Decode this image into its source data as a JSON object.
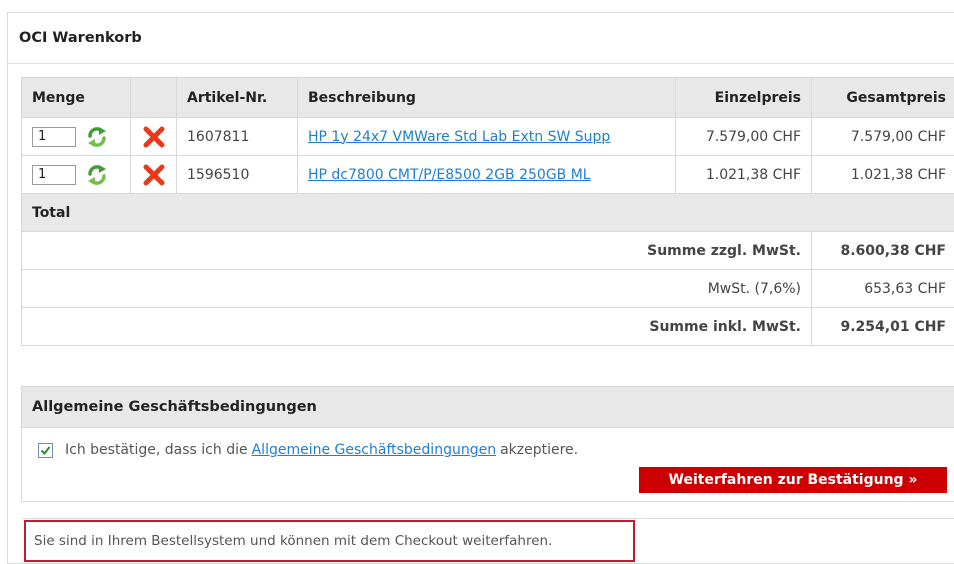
{
  "cart": {
    "title": "OCI Warenkorb",
    "columns": {
      "menge": "Menge",
      "artikel": "Artikel-Nr.",
      "beschreibung": "Beschreibung",
      "einzelpreis": "Einzelpreis",
      "gesamtpreis": "Gesamtpreis"
    },
    "items": [
      {
        "qty": "1",
        "article_no": "1607811",
        "description": "HP 1y 24x7 VMWare Std Lab Extn SW Supp",
        "unit_price": "7.579,00 CHF",
        "total_price": "7.579,00 CHF"
      },
      {
        "qty": "1",
        "article_no": "1596510",
        "description": "HP dc7800 CMT/P/E8500 2GB 250GB ML",
        "unit_price": "1.021,38 CHF",
        "total_price": "1.021,38 CHF"
      }
    ],
    "total": {
      "label": "Total",
      "subtotal_label": "Summe zzgl. MwSt.",
      "subtotal_value": "8.600,38 CHF",
      "vat_label": "MwSt. (7,6%)",
      "vat_value": "653,63 CHF",
      "grand_label": "Summe inkl. MwSt.",
      "grand_value": "9.254,01 CHF"
    }
  },
  "terms": {
    "heading": "Allgemeine Geschäftsbedingungen",
    "confirm_prefix": "Ich bestätige, dass ich die",
    "link": "Allgemeine Geschäftsbedingungen",
    "confirm_suffix": "akzeptiere.",
    "checked": true,
    "continue_button": "Weiterfahren zur Bestätigung »"
  },
  "notice": "Sie sind in Ihrem Bestellsystem und können mit dem Checkout weiterfahren.",
  "colors": {
    "accent_red": "#cc0000",
    "link_blue": "#1e7fd0",
    "notice_border": "#b91f2d",
    "header_gray": "#e8e8e8"
  },
  "icons": {
    "refresh": "refresh-arrows-icon",
    "remove": "red-x-icon",
    "check": "checkmark-icon"
  }
}
